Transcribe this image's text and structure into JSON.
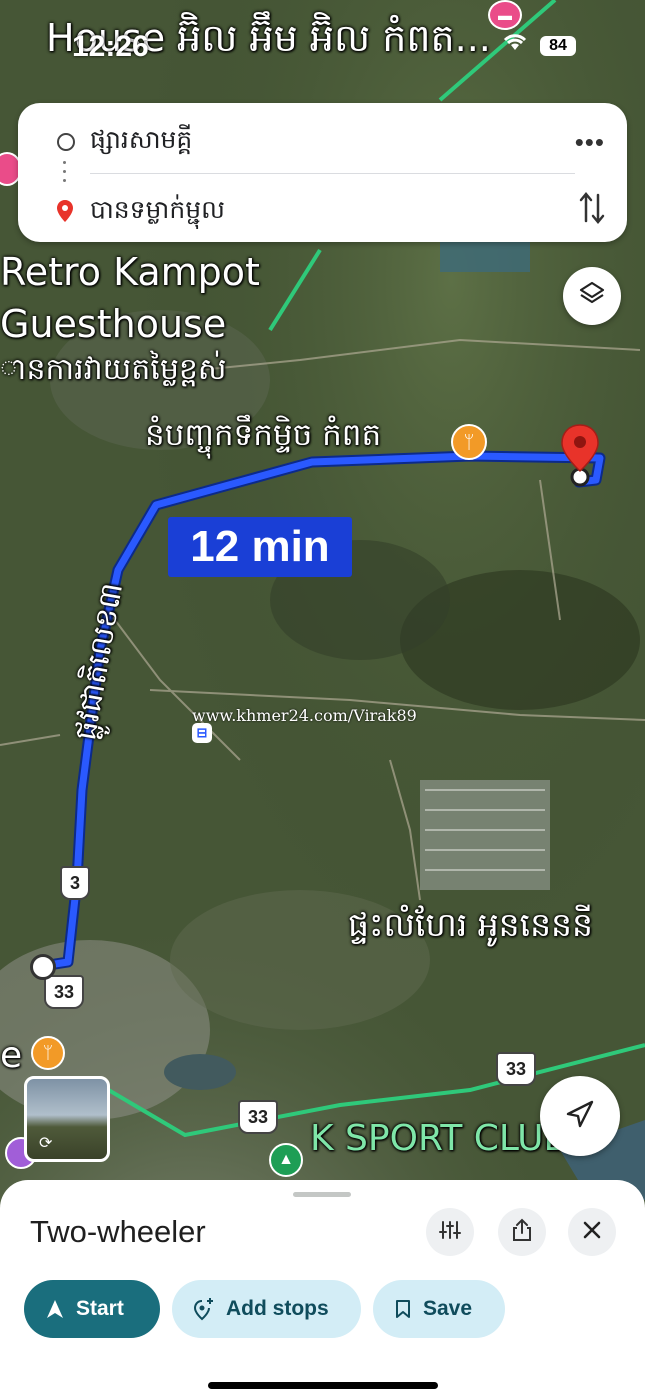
{
  "status_bar": {
    "time": "12:26",
    "battery": "84"
  },
  "search": {
    "origin": "ផ្សារសាមគ្គី",
    "destination": "បានទម្លាក់ម្ជុល"
  },
  "map_labels": {
    "top_place": "House អ៊ិល អ៊ឹម អ៊ិល កំពត...",
    "retro_line1": "Retro Kampot",
    "retro_line2": "Guesthouse",
    "khmer_price": "ានការវាយតម្លៃខ្ពស់",
    "factory": "នំបញ្ចុកទឹកម្ទិច កំពត",
    "road_name": "ផ្លូវជាតិលេខ៣",
    "road_3": "3",
    "road_33_a": "33",
    "road_33_b": "33",
    "road_33_c": "33",
    "house": "ផ្ទះលំហែរ អូននេននី",
    "sport": "K SPORT CLUB",
    "left_edge": "e",
    "watermark": "www.khmer24.com/Virak89"
  },
  "route": {
    "duration": "12 min",
    "color": "#1a3fd6"
  },
  "bottom_sheet": {
    "mode": "Two-wheeler",
    "start_label": "Start",
    "add_stops_label": "Add stops",
    "save_label": "Save"
  },
  "colors": {
    "accent": "#1a6e7d",
    "chip_bg": "#d3edf6",
    "pin": "#e8332a",
    "poi_orange": "#f29a27"
  }
}
